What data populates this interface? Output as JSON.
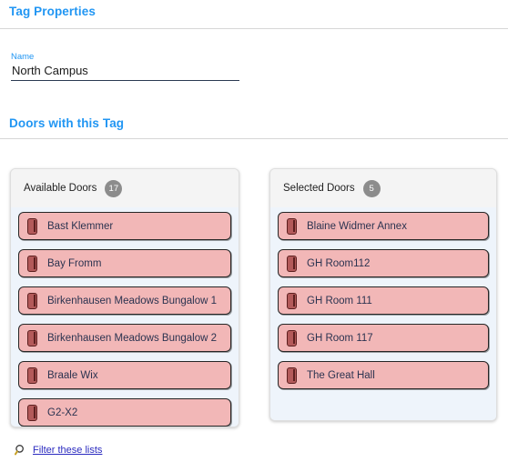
{
  "page": {
    "title": "Tag Properties",
    "section_title": "Doors with this Tag"
  },
  "name_field": {
    "label": "Name",
    "value": "North Campus",
    "placeholder": "Name"
  },
  "available_panel": {
    "label": "Available Doors",
    "count": "17",
    "items": [
      {
        "label": "Bast Klemmer",
        "icon": "door-icon"
      },
      {
        "label": "Bay Fromm",
        "icon": "door-icon"
      },
      {
        "label": "Birkenhausen Meadows Bungalow 1",
        "icon": "door-icon"
      },
      {
        "label": "Birkenhausen Meadows Bungalow 2",
        "icon": "door-icon"
      },
      {
        "label": "Braale Wix",
        "icon": "door-icon"
      },
      {
        "label": "G2-X2",
        "icon": "door-icon"
      }
    ]
  },
  "selected_panel": {
    "label": "Selected Doors",
    "count": "5",
    "items": [
      {
        "label": "Blaine Widmer Annex",
        "icon": "door-icon"
      },
      {
        "label": "GH Room112",
        "icon": "door-icon"
      },
      {
        "label": "GH Room 111",
        "icon": "door-icon"
      },
      {
        "label": "GH Room 117",
        "icon": "door-icon"
      },
      {
        "label": "The Great Hall",
        "icon": "door-icon"
      }
    ]
  },
  "filter_link": {
    "label": "Filter these lists",
    "icon": "search-icon"
  },
  "colors": {
    "accent": "#2196f3",
    "door_item_bg": "#f2b7b7",
    "door_icon": "#b35a5a",
    "list_bg": "#eef4fb",
    "badge_bg": "#8c8c8c",
    "link": "#2b2bbf"
  }
}
